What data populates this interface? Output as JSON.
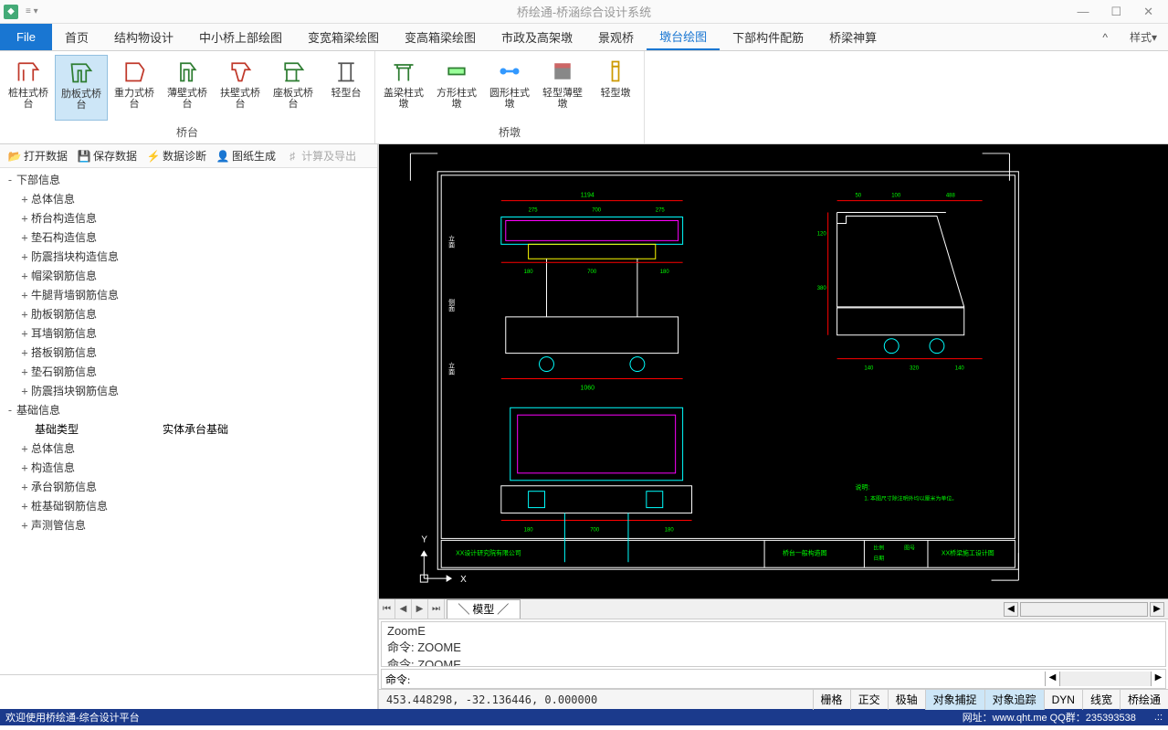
{
  "app": {
    "title": "桥绘通-桥涵综合设计系统"
  },
  "menu": {
    "file": "File",
    "tabs": [
      "首页",
      "结构物设计",
      "中小桥上部绘图",
      "变宽箱梁绘图",
      "变高箱梁绘图",
      "市政及高架墩",
      "景观桥",
      "墩台绘图",
      "下部构件配筋",
      "桥梁神算"
    ],
    "active_index": 7,
    "style_btn": "样式"
  },
  "ribbon": {
    "groups": [
      {
        "label": "桥台",
        "items": [
          "桩柱式桥台",
          "肋板式桥台",
          "重力式桥台",
          "薄壁式桥台",
          "扶壁式桥台",
          "座板式桥台",
          "轻型台"
        ],
        "active": 1
      },
      {
        "label": "桥墩",
        "items": [
          "盖梁柱式墩",
          "方形柱式墩",
          "圆形柱式墩",
          "轻型薄壁墩",
          "轻型墩"
        ]
      }
    ]
  },
  "toolbar": {
    "open": "打开数据",
    "save": "保存数据",
    "diag": "数据诊断",
    "gen": "图纸生成",
    "calc": "计算及导出"
  },
  "tree": {
    "root1": "下部信息",
    "node_overall": "总体信息",
    "node_abutment": "桥台构造信息",
    "node_pad": "垫石构造信息",
    "node_seis": "防震挡块构造信息",
    "node_cap_rebar": "帽梁钢筋信息",
    "node_leg_rebar": "牛腿背墙钢筋信息",
    "node_rib_rebar": "肋板钢筋信息",
    "node_ear_rebar": "耳墙钢筋信息",
    "node_slab_rebar": "搭板钢筋信息",
    "node_pad_rebar": "垫石钢筋信息",
    "node_seis_rebar": "防震挡块钢筋信息",
    "root2": "基础信息",
    "found_kind_k": "基础类型",
    "found_kind_v": "实体承台基础",
    "f_overall": "总体信息",
    "f_struct": "构造信息",
    "f_cap_rebar": "承台钢筋信息",
    "f_pile_rebar": "桩基础钢筋信息",
    "f_sound": "声测管信息"
  },
  "cad": {
    "model_tab": "模型",
    "cmd_hist": [
      "ZoomE",
      "命令: ZOOME",
      "命令: ZOOME"
    ],
    "cmd_prompt": "命令:",
    "coords": "453.448298,  -32.136446,  0.000000",
    "snap_btns": [
      "栅格",
      "正交",
      "极轴",
      "对象捕捉",
      "对象追踪",
      "DYN",
      "线宽",
      "桥绘通"
    ],
    "snap_active": [
      3,
      4
    ]
  },
  "status": {
    "welcome": "欢迎使用桥绘通-综合设计平台",
    "url": "网址：www.qht.me QQ群：235393538"
  }
}
